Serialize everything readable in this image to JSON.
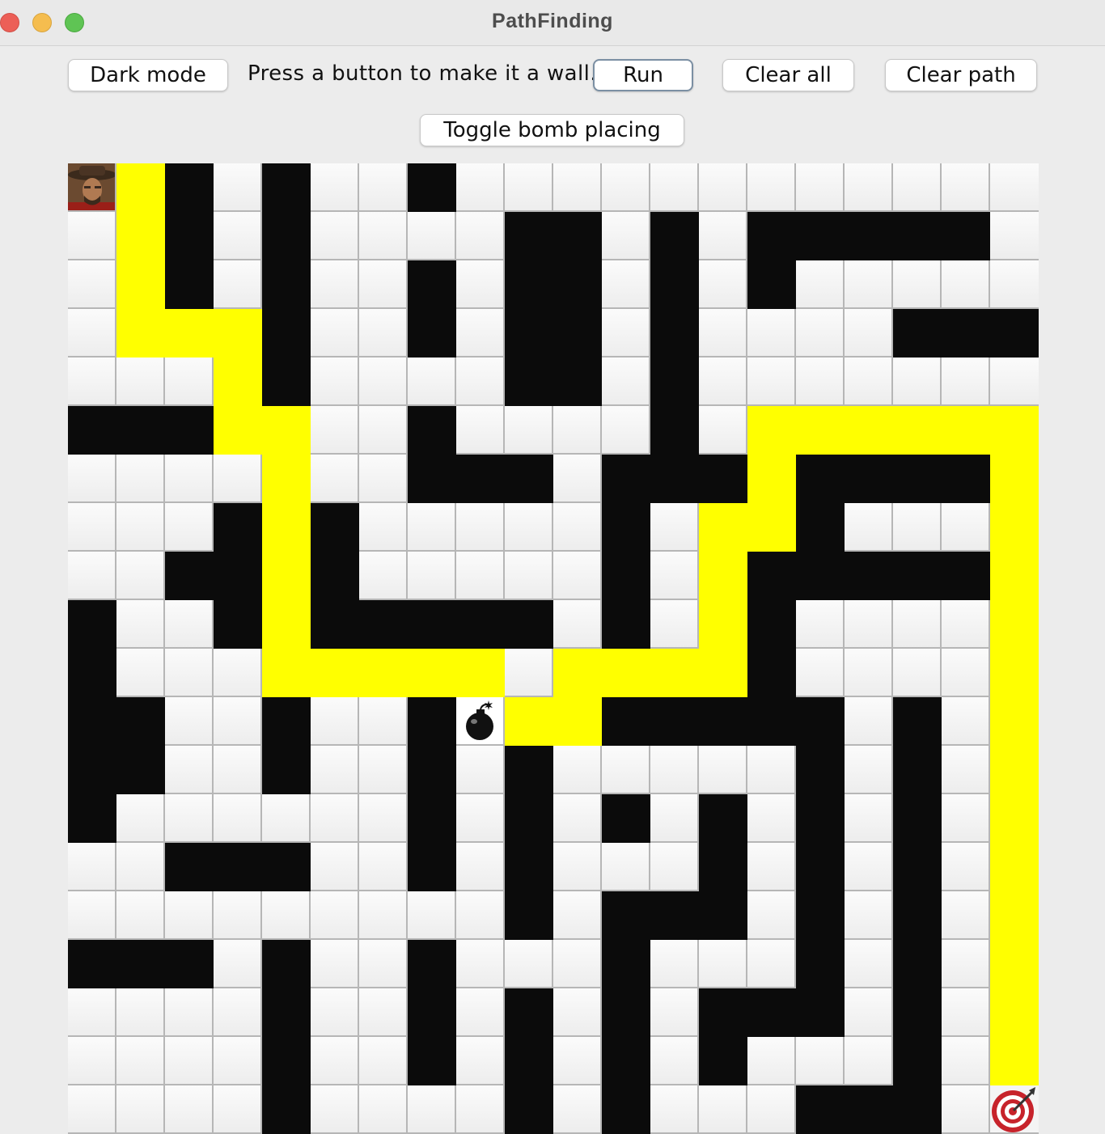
{
  "window": {
    "title": "PathFinding"
  },
  "toolbar": {
    "dark_mode_label": "Dark mode",
    "instruction": "Press a button to make it a wall.",
    "run_label": "Run",
    "clear_all_label": "Clear all",
    "clear_path_label": "Clear path",
    "toggle_bomb_label": "Toggle bomb placing"
  },
  "colors": {
    "wall": "#0b0b0b",
    "path": "#ffff00",
    "empty": "#f4f4f4",
    "window_bg": "#ececec"
  },
  "grid": {
    "rows": [
      "S#.#..#.............",
      ".#.#......####.####.",
      ".#.#..#...#..#..#....",
      ".###..#...#..#...####",
      ".....#....#.........",
      "####.....#...#......",
      "..........###.###..",
      "..........#.........",
      "..........#.........",
      "#.........#.........",
      "#...................",
      "#.....#.B......##.#.",
      "#...##.#..#.........",
      "#.........#.##.#.#..",
      ".........#...#..#.#.",
      ".........#.###..#.#.",
      "....#..#..#.#...#.#.",
      ".....#.#..#..###..#.",
      ".....#.#....#...#.#.",
      ".....#...#.#....###T"
    ],
    "cells": [
      [
        "start",
        "path",
        "wall",
        "empty",
        "wall",
        "empty",
        "empty",
        "wall",
        "empty",
        "empty",
        "empty",
        "empty",
        "empty",
        "empty",
        "empty",
        "empty",
        "empty",
        "empty",
        "empty",
        "empty"
      ],
      [
        "empty",
        "path",
        "wall",
        "empty",
        "wall",
        "empty",
        "empty",
        "empty",
        "empty",
        "wall",
        "wall",
        "empty",
        "wall",
        "empty",
        "wall",
        "wall",
        "wall",
        "wall",
        "wall",
        "empty"
      ],
      [
        "empty",
        "path",
        "wall",
        "empty",
        "wall",
        "empty",
        "empty",
        "wall",
        "empty",
        "wall",
        "wall",
        "empty",
        "wall",
        "empty",
        "wall",
        "empty",
        "empty",
        "empty",
        "empty",
        "empty"
      ],
      [
        "empty",
        "path",
        "path",
        "path",
        "wall",
        "empty",
        "empty",
        "wall",
        "empty",
        "wall",
        "wall",
        "empty",
        "wall",
        "empty",
        "empty",
        "empty",
        "empty",
        "wall",
        "wall",
        "wall"
      ],
      [
        "empty",
        "empty",
        "empty",
        "path",
        "wall",
        "empty",
        "empty",
        "empty",
        "empty",
        "wall",
        "wall",
        "empty",
        "wall",
        "empty",
        "empty",
        "empty",
        "empty",
        "empty",
        "empty",
        "empty"
      ],
      [
        "wall",
        "wall",
        "wall",
        "path",
        "path",
        "empty",
        "empty",
        "wall",
        "empty",
        "empty",
        "empty",
        "empty",
        "wall",
        "empty",
        "path",
        "path",
        "path",
        "path",
        "path",
        "path"
      ],
      [
        "empty",
        "empty",
        "empty",
        "empty",
        "path",
        "empty",
        "empty",
        "wall",
        "wall",
        "wall",
        "empty",
        "wall",
        "wall",
        "wall",
        "path",
        "wall",
        "wall",
        "wall",
        "wall",
        "path"
      ],
      [
        "empty",
        "empty",
        "empty",
        "wall",
        "path",
        "wall",
        "empty",
        "empty",
        "empty",
        "empty",
        "empty",
        "wall",
        "empty",
        "path",
        "path",
        "wall",
        "empty",
        "empty",
        "empty",
        "path"
      ],
      [
        "empty",
        "empty",
        "wall",
        "wall",
        "path",
        "wall",
        "empty",
        "empty",
        "empty",
        "empty",
        "empty",
        "wall",
        "empty",
        "path",
        "wall",
        "wall",
        "wall",
        "wall",
        "wall",
        "path"
      ],
      [
        "wall",
        "empty",
        "empty",
        "wall",
        "path",
        "wall",
        "wall",
        "wall",
        "wall",
        "wall",
        "empty",
        "wall",
        "empty",
        "path",
        "wall",
        "empty",
        "empty",
        "empty",
        "empty",
        "path"
      ],
      [
        "wall",
        "empty",
        "empty",
        "empty",
        "path",
        "path",
        "path",
        "path",
        "path",
        "empty",
        "path",
        "path",
        "path",
        "path",
        "wall",
        "empty",
        "empty",
        "empty",
        "empty",
        "path"
      ],
      [
        "wall",
        "wall",
        "empty",
        "empty",
        "wall",
        "empty",
        "empty",
        "wall",
        "bomb",
        "path",
        "path",
        "wall",
        "wall",
        "wall",
        "wall",
        "wall",
        "empty",
        "wall",
        "empty",
        "path"
      ],
      [
        "wall",
        "wall",
        "empty",
        "empty",
        "wall",
        "empty",
        "empty",
        "wall",
        "empty",
        "wall",
        "empty",
        "empty",
        "empty",
        "empty",
        "empty",
        "wall",
        "empty",
        "wall",
        "empty",
        "path"
      ],
      [
        "wall",
        "empty",
        "empty",
        "empty",
        "empty",
        "empty",
        "empty",
        "wall",
        "empty",
        "wall",
        "empty",
        "wall",
        "empty",
        "wall",
        "empty",
        "wall",
        "empty",
        "wall",
        "empty",
        "path"
      ],
      [
        "empty",
        "empty",
        "wall",
        "wall",
        "wall",
        "empty",
        "empty",
        "wall",
        "empty",
        "wall",
        "empty",
        "empty",
        "empty",
        "wall",
        "empty",
        "wall",
        "empty",
        "wall",
        "empty",
        "path"
      ],
      [
        "empty",
        "empty",
        "empty",
        "empty",
        "empty",
        "empty",
        "empty",
        "empty",
        "empty",
        "wall",
        "empty",
        "wall",
        "wall",
        "wall",
        "empty",
        "wall",
        "empty",
        "wall",
        "empty",
        "path"
      ],
      [
        "wall",
        "wall",
        "wall",
        "empty",
        "wall",
        "empty",
        "empty",
        "wall",
        "empty",
        "empty",
        "empty",
        "wall",
        "empty",
        "empty",
        "empty",
        "wall",
        "empty",
        "wall",
        "empty",
        "path"
      ],
      [
        "empty",
        "empty",
        "empty",
        "empty",
        "wall",
        "empty",
        "empty",
        "wall",
        "empty",
        "wall",
        "empty",
        "wall",
        "empty",
        "wall",
        "wall",
        "wall",
        "empty",
        "wall",
        "empty",
        "path"
      ],
      [
        "empty",
        "empty",
        "empty",
        "empty",
        "wall",
        "empty",
        "empty",
        "wall",
        "empty",
        "wall",
        "empty",
        "wall",
        "empty",
        "wall",
        "empty",
        "empty",
        "empty",
        "wall",
        "empty",
        "path"
      ],
      [
        "empty",
        "empty",
        "empty",
        "empty",
        "wall",
        "empty",
        "empty",
        "empty",
        "empty",
        "wall",
        "empty",
        "wall",
        "empty",
        "empty",
        "empty",
        "wall",
        "wall",
        "wall",
        "empty",
        "target"
      ]
    ]
  }
}
